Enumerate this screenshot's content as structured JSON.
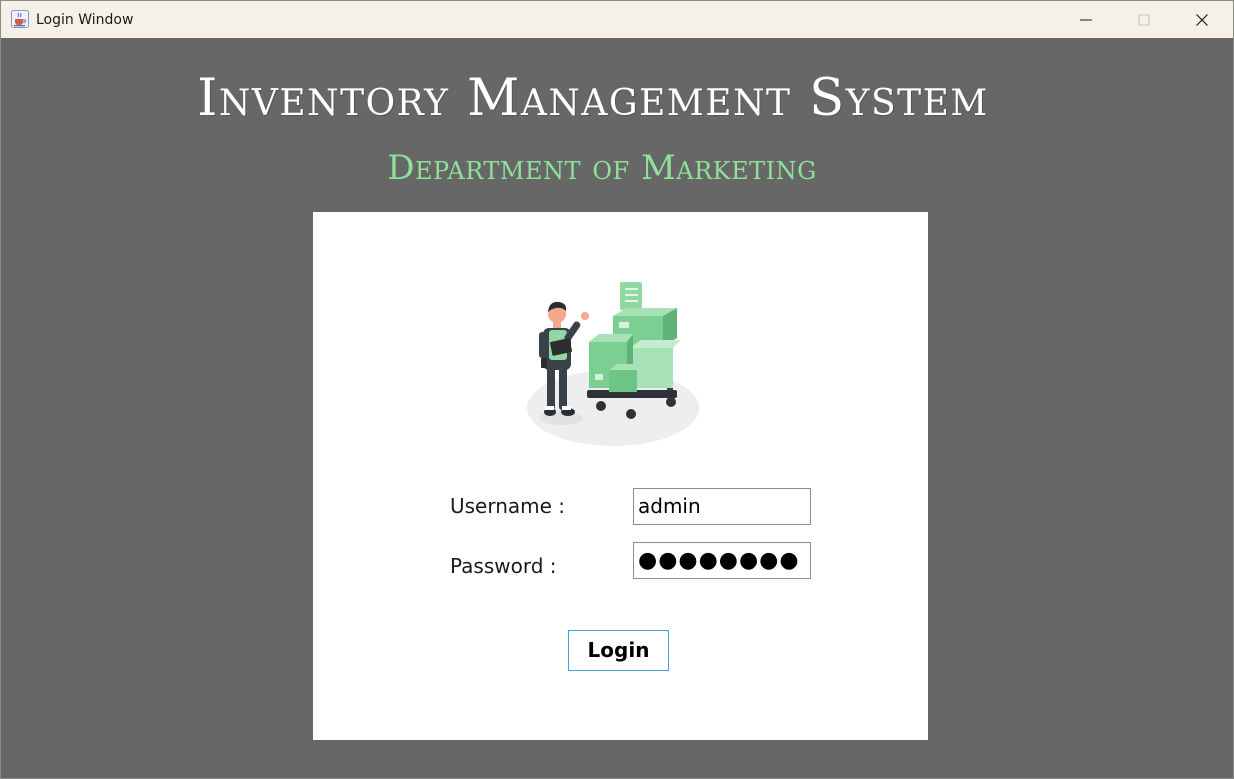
{
  "window": {
    "title": "Login Window"
  },
  "header": {
    "title": "Inventory Management System",
    "subtitle": "Department of Marketing"
  },
  "form": {
    "username_label": "Username :",
    "username_value": "admin",
    "password_label": "Password :",
    "password_value": "●●●●●●●●",
    "login_label": "Login"
  },
  "icons": {
    "app": "java-cup-icon",
    "minimize": "minimize-icon",
    "maximize": "maximize-icon",
    "close": "close-icon",
    "illustration": "warehouse-worker-illustration"
  },
  "colors": {
    "background": "#676767",
    "subtitle": "#8ee09a",
    "panel": "#ffffff",
    "login_border": "#3fa4db",
    "accent_green": "#7ccf93"
  }
}
